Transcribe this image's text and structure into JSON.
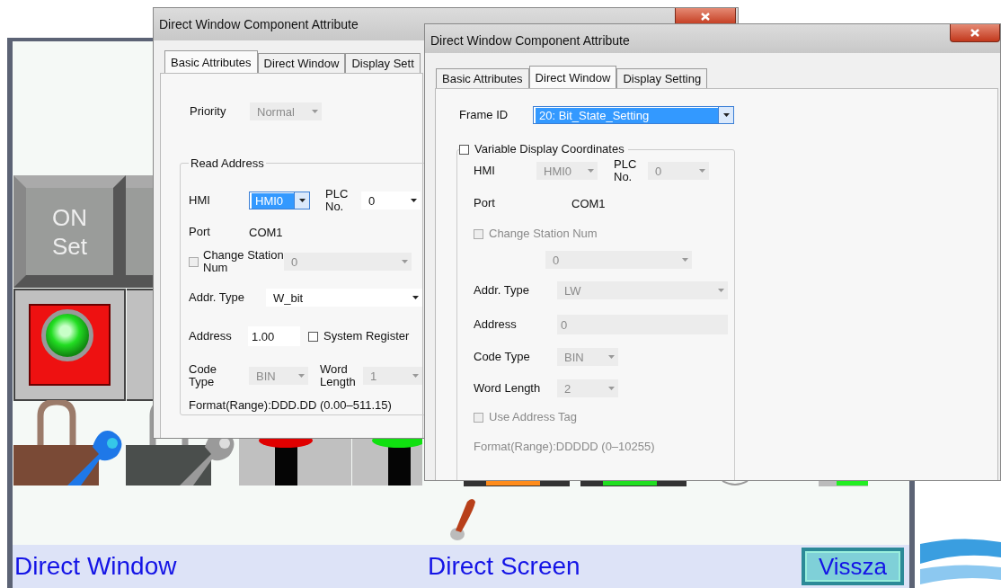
{
  "hmi_screen": {
    "set_button": {
      "lines": [
        "ON",
        "Set"
      ]
    },
    "footer": {
      "left_title": "Direct Window",
      "center_title": "Direct Screen",
      "back_button": "Vissza"
    }
  },
  "back_dialog": {
    "title": "Direct Window Component Attribute",
    "tabs": [
      {
        "label": "Basic Attributes",
        "selected": true
      },
      {
        "label": "Direct Window",
        "selected": false
      },
      {
        "label": "Display Sett",
        "selected": false
      }
    ],
    "priority": {
      "label": "Priority",
      "value": "Normal",
      "disabled": true
    },
    "read_address": {
      "legend": "Read Address",
      "hmi": {
        "label": "HMI",
        "value": "HMI0",
        "selected": true,
        "disabled": false
      },
      "plc": {
        "label": "PLC No.",
        "value": "0",
        "disabled": false
      },
      "port": {
        "label": "Port",
        "value": "COM1"
      },
      "change_station": {
        "label": "Change Station Num",
        "checked": false,
        "value": "0",
        "disabled": true
      },
      "addr_type": {
        "label": "Addr. Type",
        "value": "W_bit",
        "disabled": false
      },
      "address": {
        "label": "Address",
        "value": "1.00"
      },
      "system_register": {
        "label": "System Register",
        "checked": false
      },
      "code_type": {
        "label": "Code Type",
        "value": "BIN",
        "disabled": true
      },
      "word_length": {
        "label": "Word Length",
        "value": "1",
        "disabled": true
      },
      "format": "Format(Range):DDD.DD (0.00–511.15)"
    }
  },
  "front_dialog": {
    "title": "Direct Window Component Attribute",
    "tabs": [
      {
        "label": "Basic Attributes",
        "selected": false
      },
      {
        "label": "Direct Window",
        "selected": true
      },
      {
        "label": "Display Setting",
        "selected": false
      }
    ],
    "frame_id": {
      "label": "Frame ID",
      "value": "20: Bit_State_Setting",
      "selected": true,
      "disabled": false
    },
    "variable_coords": {
      "label": "Variable Display Coordinates",
      "checked": false,
      "hmi": {
        "label": "HMI",
        "value": "HMI0",
        "disabled": true
      },
      "plc": {
        "label": "PLC No.",
        "value": "0",
        "disabled": true
      },
      "port": {
        "label": "Port",
        "value": "COM1"
      },
      "change_station": {
        "label": "Change Station Num",
        "checked": false,
        "disabled": true
      },
      "station": {
        "value": "0",
        "disabled": true
      },
      "addr_type": {
        "label": "Addr. Type",
        "value": "LW",
        "disabled": true
      },
      "address": {
        "label": "Address",
        "value": "0",
        "disabled": true
      },
      "code_type": {
        "label": "Code Type",
        "value": "BIN",
        "disabled": true
      },
      "word_length": {
        "label": "Word Length",
        "value": "2",
        "disabled": true
      },
      "use_address_tag": {
        "label": "Use Address Tag",
        "checked": false,
        "disabled": true
      },
      "format": "Format(Range):DDDDD (0–10255)"
    }
  }
}
